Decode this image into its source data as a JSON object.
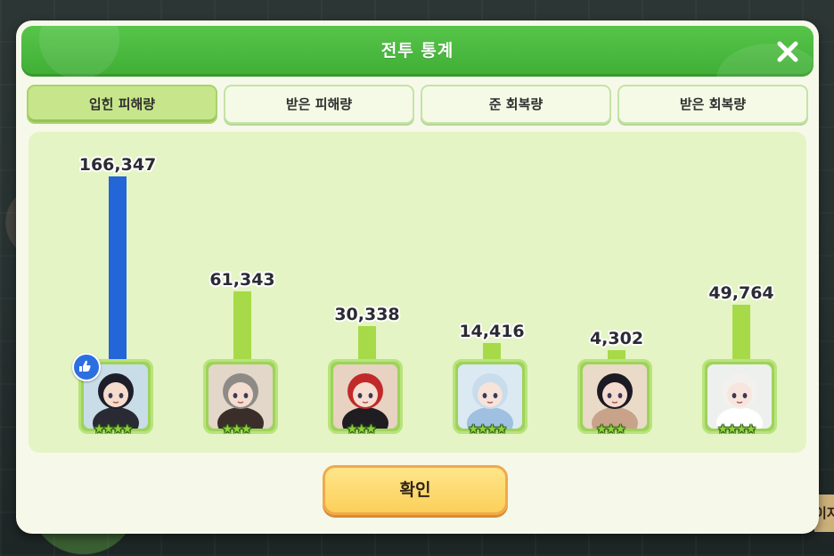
{
  "dialog": {
    "title": "전투 통계",
    "close_icon": "close-icon",
    "confirm_label": "확인"
  },
  "tabs": [
    {
      "label": "입힌 피해량",
      "active": true
    },
    {
      "label": "받은 피해량",
      "active": false
    },
    {
      "label": "준 회복량",
      "active": false
    },
    {
      "label": "받은 회복량",
      "active": false
    }
  ],
  "chart_data": {
    "type": "bar",
    "categories": [
      "",
      "",
      "",
      "",
      "",
      ""
    ],
    "values": [
      166347,
      61343,
      30338,
      14416,
      4302,
      49764
    ],
    "value_labels": [
      "166,347",
      "61,343",
      "30,338",
      "14,416",
      "4,302",
      "49,764"
    ],
    "stars": [
      4,
      3,
      3,
      4,
      3,
      4
    ],
    "highlight_index": 0,
    "colors": {
      "top_bar": "#2266d8",
      "bar": "#a7da48"
    }
  },
  "characters": [
    {
      "portrait": "dark-haired-hooded-character",
      "has_badge": true
    },
    {
      "portrait": "grey-haired-character"
    },
    {
      "portrait": "red-haired-officer-character"
    },
    {
      "portrait": "blue-haired-braided-character"
    },
    {
      "portrait": "black-haired-flower-character"
    },
    {
      "portrait": "white-haired-character"
    }
  ],
  "background": {
    "right_edge_text": "이지"
  }
}
